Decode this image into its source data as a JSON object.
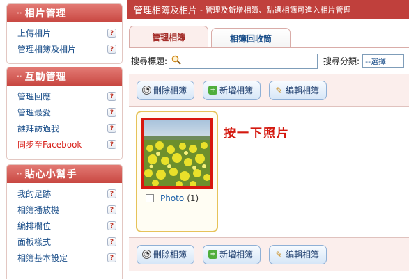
{
  "sidebar": {
    "sections": [
      {
        "title": "相片管理",
        "items": [
          {
            "label": "上傳相片"
          },
          {
            "label": "管理相簿及相片"
          }
        ]
      },
      {
        "title": "互動管理",
        "items": [
          {
            "label": "管理回應"
          },
          {
            "label": "管理最愛"
          },
          {
            "label": "誰拜訪過我"
          },
          {
            "label": "同步至Facebook"
          }
        ]
      },
      {
        "title": "貼心小幫手",
        "items": [
          {
            "label": "我的足跡"
          },
          {
            "label": "相簿播放機"
          },
          {
            "label": "編排欄位"
          },
          {
            "label": "面板樣式"
          },
          {
            "label": "相簿基本設定"
          }
        ]
      }
    ],
    "help_glyph": "?",
    "head_marker": "∙∙"
  },
  "main": {
    "title": "管理相簿及相片",
    "subtitle": "- 管理及新增相簿、點選相簿可進入相片管理",
    "tabs": [
      {
        "label": "管理相簿"
      },
      {
        "label": "相簿回收筒"
      }
    ],
    "search": {
      "label": "搜尋標題:",
      "value": "",
      "placeholder": "",
      "category_label": "搜尋分類:",
      "category_value": "--選擇"
    },
    "toolbar": {
      "delete_label": "刪除相簿",
      "add_label": "新增相簿",
      "edit_label": "編輯相簿",
      "add_glyph": "+",
      "edit_glyph": "✎",
      "delete_glyph": "◔"
    },
    "album": {
      "name": "Photo",
      "count": "(1)"
    },
    "hint": "按一下照片"
  },
  "colors": {
    "brand": "#c0403c",
    "tab_active": "#a42d29",
    "link": "#1b4f8a",
    "highlight": "#d8170f"
  },
  "icons": {
    "search": "search-icon",
    "help": "help-icon",
    "delete": "trash-icon",
    "add": "plus-icon",
    "edit": "pencil-icon"
  }
}
